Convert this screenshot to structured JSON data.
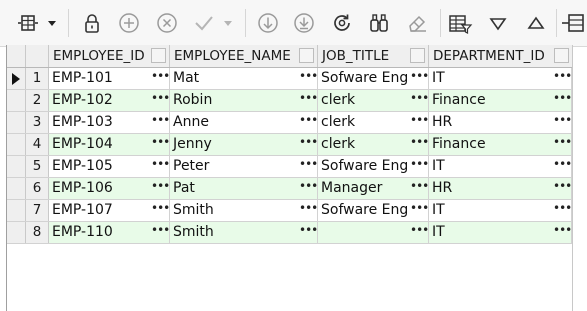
{
  "toolbar": {
    "icons": [
      "grid-view-icon",
      "dropdown-arrow-icon",
      "lock-icon",
      "add-row-icon",
      "delete-row-icon",
      "commit-icon",
      "commit-dropdown-icon",
      "move-down-icon",
      "save-icon",
      "refresh-icon",
      "find-binoculars-icon",
      "clear-eraser-icon",
      "grid-filter-icon",
      "sort-descending-icon",
      "sort-ascending-icon",
      "split-view-icon"
    ]
  },
  "grid": {
    "columns": [
      "EMPLOYEE_ID",
      "EMPLOYEE_NAME",
      "JOB_TITLE",
      "DEPARTMENT_ID"
    ],
    "ellipsis": "•••",
    "rows": [
      {
        "num": "1",
        "EMPLOYEE_ID": "EMP-101",
        "EMPLOYEE_NAME": "Mat",
        "JOB_TITLE": "Sofware Eng",
        "DEPARTMENT_ID": "IT",
        "current": true
      },
      {
        "num": "2",
        "EMPLOYEE_ID": "EMP-102",
        "EMPLOYEE_NAME": "Robin",
        "JOB_TITLE": "clerk",
        "DEPARTMENT_ID": "Finance"
      },
      {
        "num": "3",
        "EMPLOYEE_ID": "EMP-103",
        "EMPLOYEE_NAME": "Anne",
        "JOB_TITLE": "clerk",
        "DEPARTMENT_ID": "HR"
      },
      {
        "num": "4",
        "EMPLOYEE_ID": "EMP-104",
        "EMPLOYEE_NAME": "Jenny",
        "JOB_TITLE": "clerk",
        "DEPARTMENT_ID": "Finance"
      },
      {
        "num": "5",
        "EMPLOYEE_ID": "EMP-105",
        "EMPLOYEE_NAME": "Peter",
        "JOB_TITLE": "Sofware Eng",
        "DEPARTMENT_ID": "IT"
      },
      {
        "num": "6",
        "EMPLOYEE_ID": "EMP-106",
        "EMPLOYEE_NAME": "Pat",
        "JOB_TITLE": "Manager",
        "DEPARTMENT_ID": "HR"
      },
      {
        "num": "7",
        "EMPLOYEE_ID": "EMP-107",
        "EMPLOYEE_NAME": "Smith",
        "JOB_TITLE": "Sofware Eng",
        "DEPARTMENT_ID": "IT"
      },
      {
        "num": "8",
        "EMPLOYEE_ID": "EMP-110",
        "EMPLOYEE_NAME": "Smith",
        "JOB_TITLE": "",
        "DEPARTMENT_ID": "IT"
      }
    ]
  },
  "colors": {
    "even_row": "#e8fbe8",
    "header_bg": "#efefef",
    "icon_gray": "#9a9a9a",
    "icon_dark": "#333333"
  }
}
